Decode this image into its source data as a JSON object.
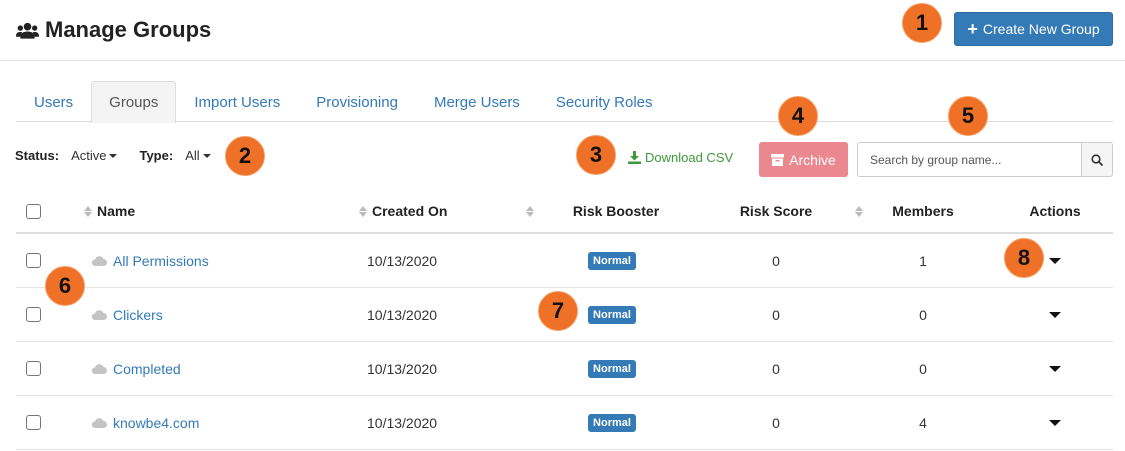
{
  "header": {
    "title": "Manage Groups",
    "create_label": "Create New Group"
  },
  "tabs": [
    {
      "label": "Users",
      "active": false
    },
    {
      "label": "Groups",
      "active": true
    },
    {
      "label": "Import Users",
      "active": false
    },
    {
      "label": "Provisioning",
      "active": false
    },
    {
      "label": "Merge Users",
      "active": false
    },
    {
      "label": "Security Roles",
      "active": false
    }
  ],
  "filters": {
    "status_label": "Status:",
    "status_value": "Active",
    "type_label": "Type:",
    "type_value": "All"
  },
  "toolbar": {
    "download_label": "Download CSV",
    "archive_label": "Archive",
    "search_placeholder": "Search by group name..."
  },
  "table": {
    "columns": {
      "name": "Name",
      "created_on": "Created On",
      "risk_booster": "Risk Booster",
      "risk_score": "Risk Score",
      "members": "Members",
      "actions": "Actions"
    },
    "rows": [
      {
        "name": "All Permissions",
        "created_on": "10/13/2020",
        "risk_booster": "Normal",
        "risk_score": "0",
        "members": "1"
      },
      {
        "name": "Clickers",
        "created_on": "10/13/2020",
        "risk_booster": "Normal",
        "risk_score": "0",
        "members": "0"
      },
      {
        "name": "Completed",
        "created_on": "10/13/2020",
        "risk_booster": "Normal",
        "risk_score": "0",
        "members": "0"
      },
      {
        "name": "knowbe4.com",
        "created_on": "10/13/2020",
        "risk_booster": "Normal",
        "risk_score": "0",
        "members": "4"
      }
    ]
  },
  "callouts": [
    "1",
    "2",
    "3",
    "4",
    "5",
    "6",
    "7",
    "8"
  ],
  "colors": {
    "primary": "#337ab7",
    "archive": "#ea878f",
    "download": "#3c9a3c",
    "callout": "#ef7027"
  },
  "icons": {
    "title": "users-icon",
    "create": "plus-icon",
    "download": "download-icon",
    "archive": "archive-box-icon",
    "search": "search-icon",
    "group_row": "cloud-icon"
  }
}
